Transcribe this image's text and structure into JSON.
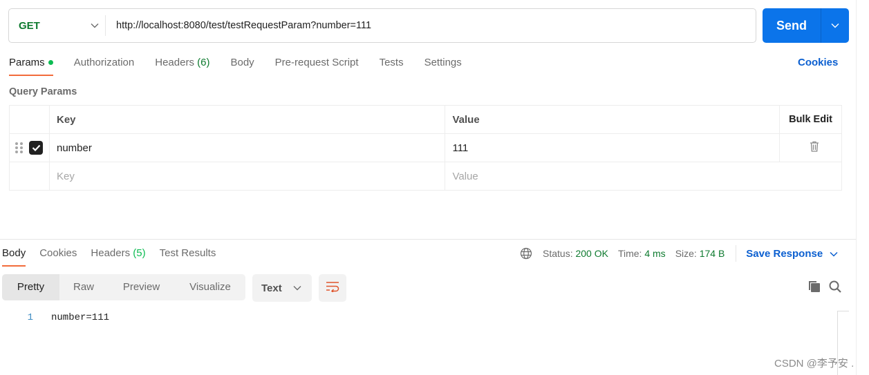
{
  "request": {
    "method": "GET",
    "url": "http://localhost:8080/test/testRequestParam?number=111",
    "send_label": "Send"
  },
  "request_tabs": [
    {
      "label": "Params",
      "active": true,
      "indicator": "dot"
    },
    {
      "label": "Authorization"
    },
    {
      "label": "Headers",
      "count": "(6)"
    },
    {
      "label": "Body"
    },
    {
      "label": "Pre-request Script"
    },
    {
      "label": "Tests"
    },
    {
      "label": "Settings"
    }
  ],
  "cookies_link": "Cookies",
  "query_params": {
    "title": "Query Params",
    "headers": {
      "key": "Key",
      "value": "Value",
      "bulk_edit": "Bulk Edit"
    },
    "rows": [
      {
        "enabled": true,
        "key": "number",
        "value": "111"
      }
    ],
    "new_row": {
      "key_placeholder": "Key",
      "value_placeholder": "Value"
    }
  },
  "response_tabs": [
    {
      "label": "Body",
      "active": true
    },
    {
      "label": "Cookies"
    },
    {
      "label": "Headers",
      "count": "(5)"
    },
    {
      "label": "Test Results"
    }
  ],
  "response_meta": {
    "status_label": "Status:",
    "status_value": "200 OK",
    "time_label": "Time:",
    "time_value": "4 ms",
    "size_label": "Size:",
    "size_value": "174 B",
    "save_label": "Save Response"
  },
  "view_modes": [
    "Pretty",
    "Raw",
    "Preview",
    "Visualize"
  ],
  "active_view_mode": "Pretty",
  "format": "Text",
  "response_body": [
    {
      "line": "1",
      "text": "number=111"
    }
  ],
  "watermark": "CSDN @李予安 .",
  "colors": {
    "accent_blue": "#0b74ea",
    "link_blue": "#0b5fd0",
    "active_tab_underline": "#f26b3a",
    "status_green": "#0e7a2f",
    "indicator_green": "#0cbb52"
  }
}
